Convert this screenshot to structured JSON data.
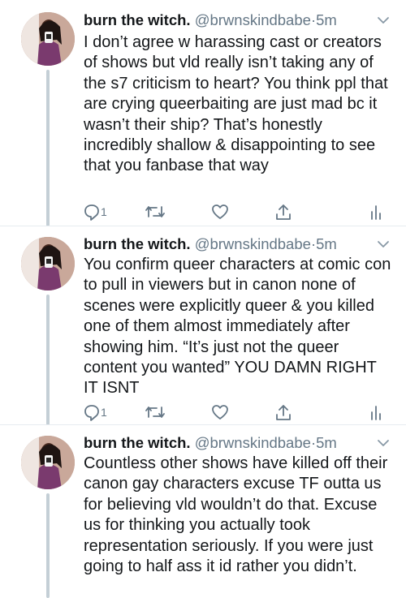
{
  "tweets": [
    {
      "name": "burn the witch.",
      "handle": "@brwnskindbabe",
      "dot": "·",
      "time": "5m",
      "text": "I don’t agree w harassing cast or creators of shows but vld really isn’t taking any of the s7 criticism to heart? You think ppl that are crying queerbaiting are just mad bc it wasn’t their ship? That’s honestly incredibly shallow & disappointing to see that you fanbase that way",
      "reply_count": "1",
      "avatar_icon": "profile-photo"
    },
    {
      "name": "burn the witch.",
      "handle": "@brwnskindbabe",
      "dot": "·",
      "time": "5m",
      "text": "You confirm queer characters at comic con to pull in viewers but in canon none of scenes were explicitly queer & you killed one of them almost immediately after showing him. “It’s just not the queer content you wanted” YOU DAMN RIGHT IT ISNT",
      "reply_count": "1",
      "avatar_icon": "profile-photo"
    },
    {
      "name": "burn the witch.",
      "handle": "@brwnskindbabe",
      "dot": "·",
      "time": "5m",
      "text": "Countless other shows have killed off their canon gay characters excuse TF outta us for believing vld wouldn’t do that. Excuse us for thinking you actually took representation seriously. If you were just going to half ass it id rather you didn’t.",
      "reply_count": "",
      "avatar_icon": "profile-photo"
    }
  ],
  "icons": {
    "reply": "reply-icon",
    "retweet": "retweet-icon",
    "like": "heart-icon",
    "share": "share-icon",
    "analytics": "analytics-icon",
    "caret": "chevron-down-icon"
  },
  "colors": {
    "text": "#14171a",
    "secondary": "#657786",
    "thread_line": "#c4cfd6",
    "divider": "#e6ecf0"
  }
}
